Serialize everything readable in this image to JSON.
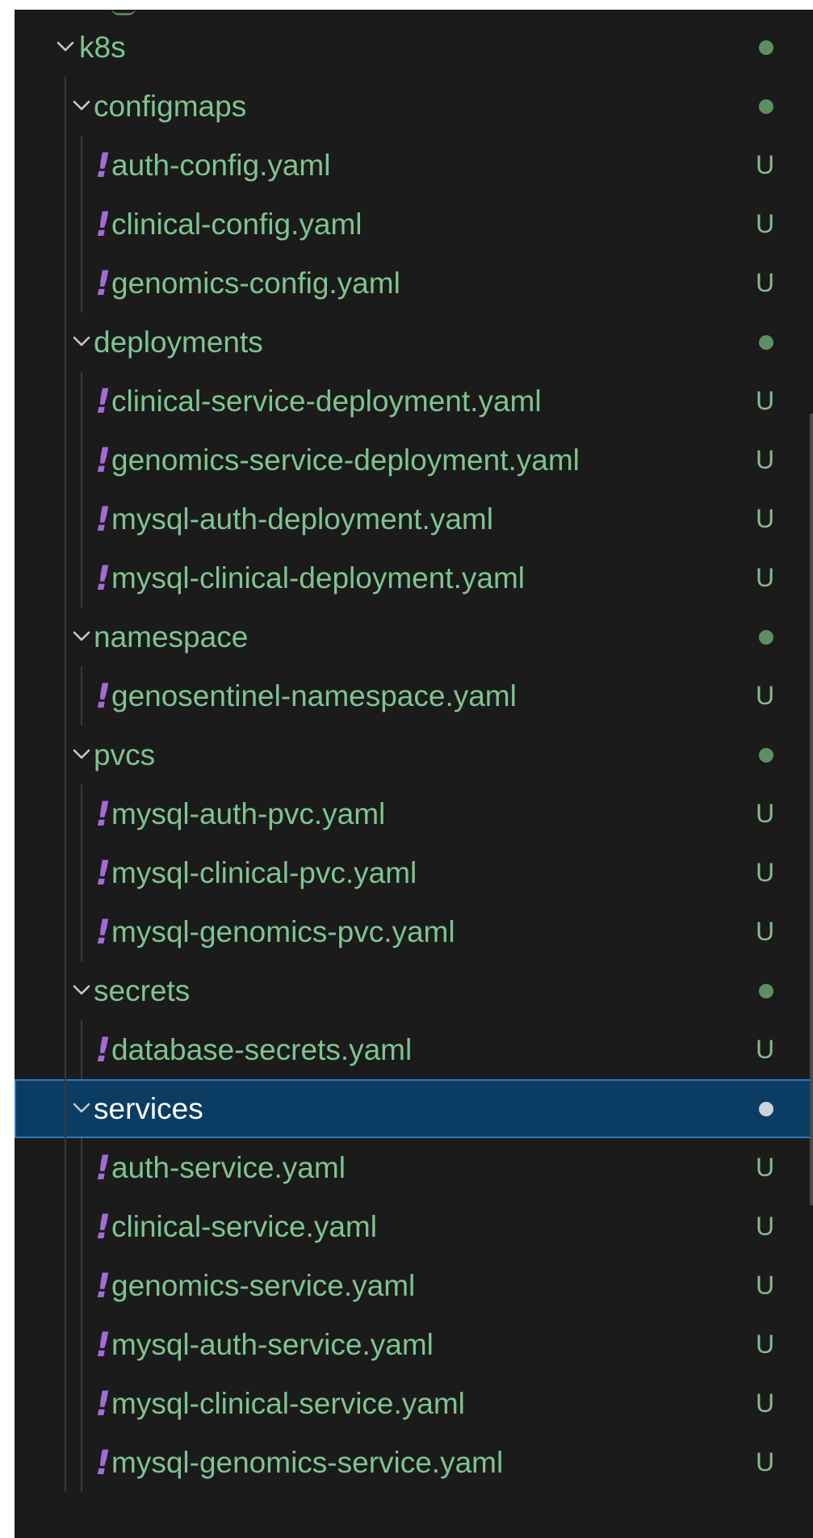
{
  "explorer": {
    "root": {
      "label": "k8s"
    },
    "folders": [
      {
        "label": "configmaps",
        "files": [
          {
            "label": "auth-config.yaml",
            "status": "U"
          },
          {
            "label": "clinical-config.yaml",
            "status": "U"
          },
          {
            "label": "genomics-config.yaml",
            "status": "U"
          }
        ]
      },
      {
        "label": "deployments",
        "files": [
          {
            "label": "clinical-service-deployment.yaml",
            "status": "U"
          },
          {
            "label": "genomics-service-deployment.yaml",
            "status": "U"
          },
          {
            "label": "mysql-auth-deployment.yaml",
            "status": "U"
          },
          {
            "label": "mysql-clinical-deployment.yaml",
            "status": "U"
          }
        ]
      },
      {
        "label": "namespace",
        "files": [
          {
            "label": "genosentinel-namespace.yaml",
            "status": "U"
          }
        ]
      },
      {
        "label": "pvcs",
        "files": [
          {
            "label": "mysql-auth-pvc.yaml",
            "status": "U"
          },
          {
            "label": "mysql-clinical-pvc.yaml",
            "status": "U"
          },
          {
            "label": "mysql-genomics-pvc.yaml",
            "status": "U"
          }
        ]
      },
      {
        "label": "secrets",
        "files": [
          {
            "label": "database-secrets.yaml",
            "status": "U"
          }
        ]
      },
      {
        "label": "services",
        "selected": true,
        "files": [
          {
            "label": "auth-service.yaml",
            "status": "U"
          },
          {
            "label": "clinical-service.yaml",
            "status": "U"
          },
          {
            "label": "genomics-service.yaml",
            "status": "U"
          },
          {
            "label": "mysql-auth-service.yaml",
            "status": "U"
          },
          {
            "label": "mysql-clinical-service.yaml",
            "status": "U"
          },
          {
            "label": "mysql-genomics-service.yaml",
            "status": "U"
          }
        ]
      }
    ],
    "icons": {
      "chevron": "chevron-down-icon",
      "yaml_file": "exclamation-yaml-icon",
      "modified_dot": "dot-icon"
    },
    "colors": {
      "background": "#1b1b1b",
      "text_untracked": "#7ec48f",
      "yaml_icon": "#a46bd6",
      "selection_bg": "#0b3c63",
      "selection_border": "#2f79c7"
    }
  }
}
